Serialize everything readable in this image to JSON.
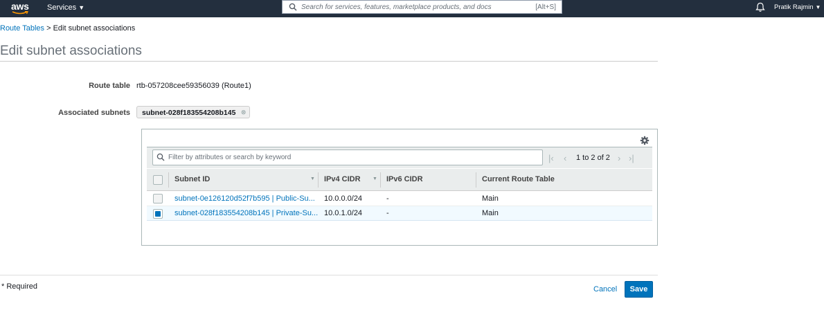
{
  "nav": {
    "logo": "aws",
    "services_label": "Services",
    "search_placeholder": "Search for services, features, marketplace products, and docs",
    "search_shortcut": "[Alt+S]",
    "user_name": "Pratik Rajmin"
  },
  "breadcrumb": {
    "parent": "Route Tables",
    "separator": " > ",
    "current": "Edit subnet associations"
  },
  "page_title": "Edit subnet associations",
  "form": {
    "route_table_label": "Route table",
    "route_table_value": "rtb-057208cee59356039 (Route1)",
    "associated_subnets_label": "Associated subnets",
    "associated_subnet_tag": "subnet-028f183554208b145"
  },
  "table": {
    "filter_placeholder": "Filter by attributes or search by keyword",
    "pagination": "1 to 2 of 2",
    "columns": [
      "Subnet ID",
      "IPv4 CIDR",
      "IPv6 CIDR",
      "Current Route Table"
    ],
    "rows": [
      {
        "subnet_id": "subnet-0e126120d52f7b595 | Public-Su...",
        "ipv4": "10.0.0.0/24",
        "ipv6": "-",
        "route_table": "Main",
        "selected": false
      },
      {
        "subnet_id": "subnet-028f183554208b145 | Private-Su...",
        "ipv4": "10.0.1.0/24",
        "ipv6": "-",
        "route_table": "Main",
        "selected": true
      }
    ]
  },
  "footer": {
    "required_note": "* Required",
    "cancel_label": "Cancel",
    "save_label": "Save"
  },
  "colors": {
    "nav_bg": "#232f3e",
    "link": "#0073bb",
    "primary_button": "#0073bb",
    "selected_row": "#f1faff"
  }
}
